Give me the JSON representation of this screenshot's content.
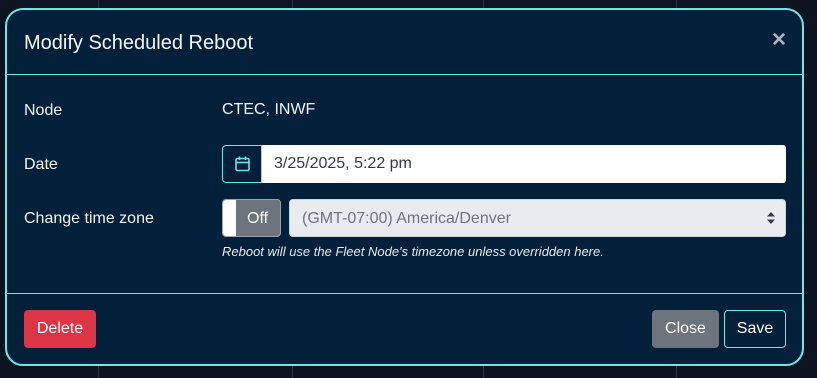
{
  "modal": {
    "title": "Modify Scheduled Reboot",
    "close_glyph": "×"
  },
  "form": {
    "node_label": "Node",
    "node_value": "CTEC, INWF",
    "date_label": "Date",
    "date_value": "3/25/2025, 5:22 pm",
    "timezone_label": "Change time zone",
    "timezone_toggle": "Off",
    "timezone_value": "(GMT-07:00) America/Denver",
    "help_text": "Reboot will use the Fleet Node's timezone unless overridden here."
  },
  "footer": {
    "delete_label": "Delete",
    "close_label": "Close",
    "save_label": "Save"
  },
  "icons": {
    "calendar": "calendar-icon",
    "close": "close-icon",
    "select_caret": "sort-caret-icon"
  },
  "colors": {
    "accent": "#6fe6e6",
    "modal_bg": "#02203a",
    "danger": "#dc3545",
    "secondary": "#6c757d"
  }
}
